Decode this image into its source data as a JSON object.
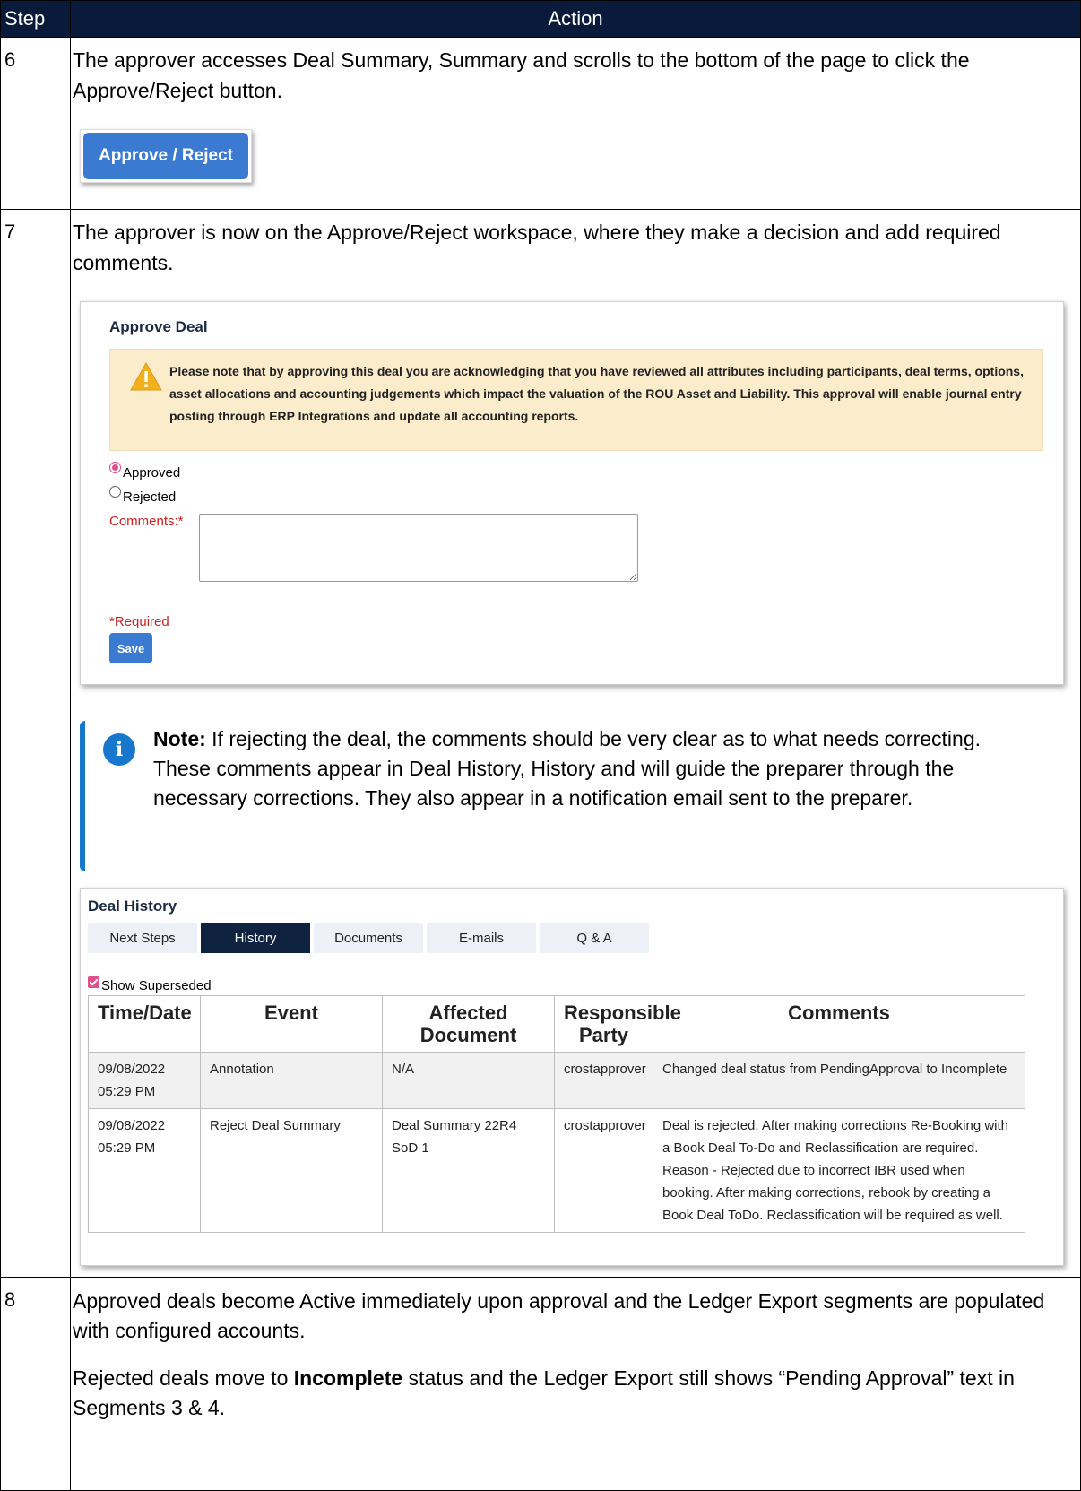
{
  "header": {
    "step": "Step",
    "action": "Action"
  },
  "step6": {
    "number": "6",
    "text": "The approver accesses Deal Summary, Summary and scrolls to the bottom of the page to click the Approve/Reject button.",
    "button_label": "Approve / Reject"
  },
  "step7": {
    "number": "7",
    "text": "The approver is now on the Approve/Reject workspace, where they make a decision and add required comments.",
    "panel": {
      "title": "Approve Deal",
      "warning": "Please note that by approving this deal you are acknowledging that you have reviewed all attributes including participants, deal terms, options, asset allocations and accounting judgements which impact the valuation of the ROU Asset and Liability. This approval will enable journal entry posting through ERP Integrations and update all accounting reports.",
      "approved_label": "Approved",
      "rejected_label": "Rejected",
      "selected": "Approved",
      "comments_label": "Comments:*",
      "comments_value": "",
      "required_note": "*Required",
      "save_label": "Save"
    },
    "note": {
      "lead": "Note:",
      "text": " If rejecting the deal, the comments should be very clear as to what needs correcting. These comments appear in Deal History, History and will guide the preparer through the necessary corrections. They also appear in a notification email sent to the preparer."
    },
    "history": {
      "title": "Deal History",
      "tabs": [
        "Next Steps",
        "History",
        "Documents",
        "E-mails",
        "Q & A"
      ],
      "active_tab": "History",
      "show_superseded_label": "Show Superseded",
      "show_superseded_checked": true,
      "columns": [
        "Time/Date",
        "Event",
        "Affected Document",
        "Responsible Party",
        "Comments"
      ],
      "rows": [
        {
          "time": "09/08/2022 05:29 PM",
          "event": "Annotation",
          "document": "N/A",
          "party": "crostapprover",
          "comments": "Changed deal status from PendingApproval to Incomplete"
        },
        {
          "time": "09/08/2022 05:29 PM",
          "event": "Reject Deal Summary",
          "document": "Deal Summary 22R4 SoD 1",
          "party": "crostapprover",
          "comments": "Deal is rejected. After making corrections Re-Booking with a Book Deal To-Do and Reclassification are required. Reason - Rejected due to incorrect IBR used when booking. After making corrections, rebook by creating a Book Deal ToDo. Reclassification will be required as well."
        }
      ]
    }
  },
  "step8": {
    "number": "8",
    "text1": "Approved deals become Active immediately upon approval and the Ledger Export segments are populated with configured accounts.",
    "text2_prefix": "Rejected deals move to ",
    "text2_bold": "Incomplete",
    "text2_suffix": " status and the Ledger Export still shows “Pending Approval” text in Segments 3 & 4."
  },
  "colors": {
    "header_bg": "#0a1a3a",
    "button_blue": "#3a7bd1",
    "warning_bg": "#fbeccc",
    "required_red": "#d02020",
    "radio_pink": "#e0508a",
    "note_blue": "#1677cc",
    "active_tab": "#0f2240"
  }
}
